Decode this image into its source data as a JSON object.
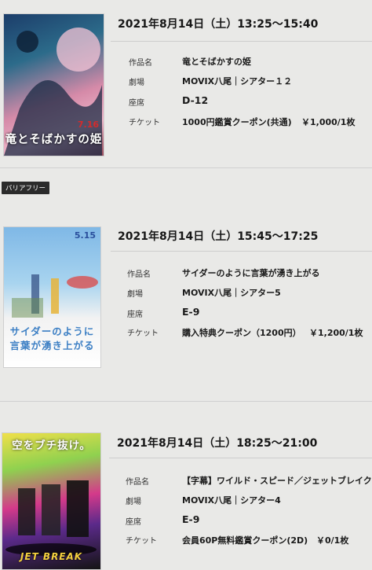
{
  "labels": {
    "title": "作品名",
    "theater": "劇場",
    "seat": "座席",
    "ticket": "チケット"
  },
  "barrier_free": "バリアフリー",
  "reservations": [
    {
      "datetime": "2021年8月14日（土）13:25～15:40",
      "title": "竜とそばかすの姫",
      "theater": "MOVIX八尾｜シアター１２",
      "seat": "D-12",
      "ticket": "1000円鑑賞クーポン(共通)",
      "price": "￥1,000/1枚",
      "poster_title": "竜とそばかすの姫",
      "poster_date": "7.16"
    },
    {
      "datetime": "2021年8月14日（土）15:45～17:25",
      "title": "サイダーのように言葉が湧き上がる",
      "theater": "MOVIX八尾｜シアター5",
      "seat": "E-9",
      "ticket": "購入特典クーポン（1200円）",
      "price": "￥1,200/1枚",
      "poster_title": "サイダーのように言葉が湧き上がる",
      "poster_date": "5.15"
    },
    {
      "datetime": "2021年8月14日（土）18:25～21:00",
      "title": "【字幕】ワイルド・スピード／ジェットブレイク",
      "theater": "MOVIX八尾｜シアター4",
      "seat": "E-9",
      "ticket": "会員60P無料鑑賞クーポン(2D)",
      "price": "￥0/1枚",
      "poster_title": "空をブチ抜け。",
      "poster_sub": "JET BREAK"
    }
  ]
}
